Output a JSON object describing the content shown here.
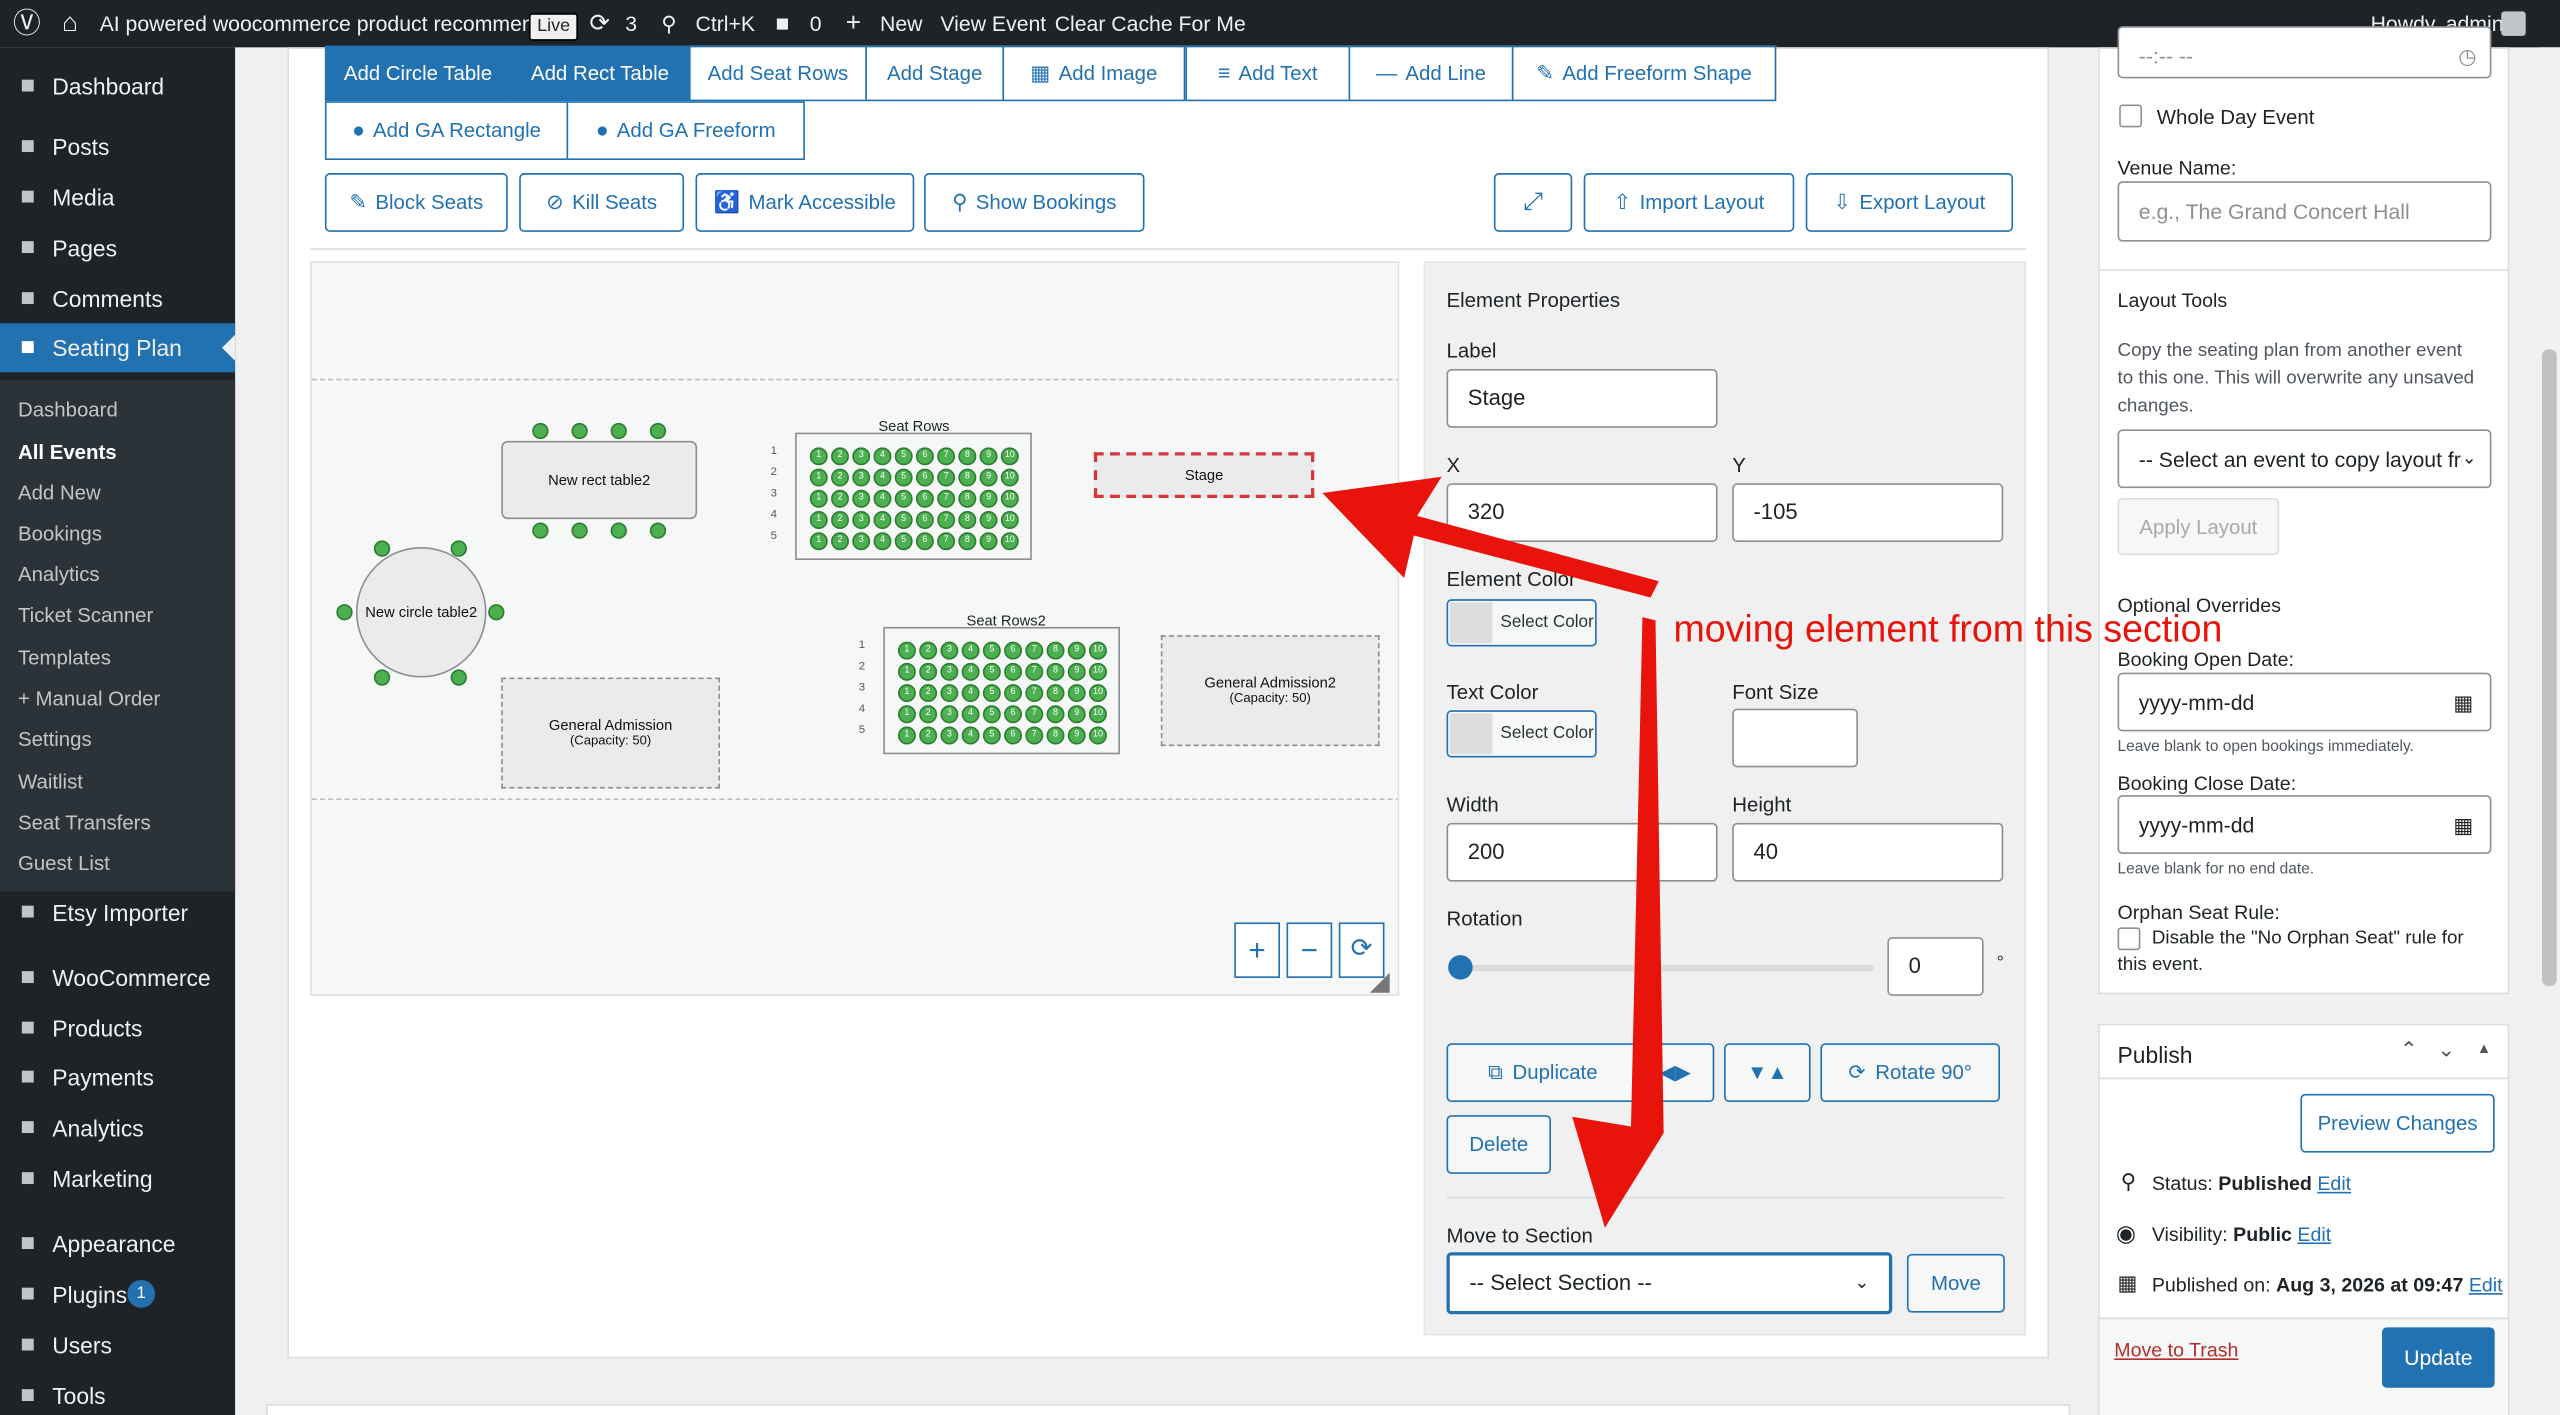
{
  "admin_bar": {
    "site_name": "AI powered woocommerce product recommend...",
    "live_badge": "Live",
    "updates_count": "3",
    "search_shortcut": "Ctrl+K",
    "comments_count": "0",
    "new_label": "New",
    "view_event_label": "View Event",
    "clear_cache_label": "Clear Cache For Me",
    "howdy": "Howdy, admin"
  },
  "sidebar": {
    "items": [
      {
        "label": "Dashboard",
        "icon": "dashboard-icon"
      },
      {
        "label": "Posts",
        "icon": "pin-icon"
      },
      {
        "label": "Media",
        "icon": "media-icon"
      },
      {
        "label": "Pages",
        "icon": "pages-icon"
      },
      {
        "label": "Comments",
        "icon": "comment-icon"
      },
      {
        "label": "Seating Plan",
        "icon": "seating-icon"
      },
      {
        "label": "Etsy Importer",
        "icon": "importer-icon"
      },
      {
        "label": "WooCommerce",
        "icon": "woo-icon"
      },
      {
        "label": "Products",
        "icon": "products-icon"
      },
      {
        "label": "Payments",
        "icon": "payments-icon"
      },
      {
        "label": "Analytics",
        "icon": "analytics-icon"
      },
      {
        "label": "Marketing",
        "icon": "marketing-icon"
      },
      {
        "label": "Appearance",
        "icon": "brush-icon"
      },
      {
        "label": "Plugins",
        "icon": "plugin-icon"
      },
      {
        "label": "Users",
        "icon": "users-icon"
      },
      {
        "label": "Tools",
        "icon": "tools-icon"
      }
    ],
    "plugins_badge": "1",
    "submenu": [
      "Dashboard",
      "All Events",
      "Add New",
      "Bookings",
      "Analytics",
      "Ticket Scanner",
      "Templates",
      "+ Manual Order",
      "Settings",
      "Waitlist",
      "Seat Transfers",
      "Guest List"
    ]
  },
  "toolbar": {
    "row1": [
      "Add Circle Table",
      "Add Rect Table",
      "Add Seat Rows",
      "Add Stage",
      "Add Image",
      "Add Text",
      "Add Line",
      "Add Freeform Shape"
    ],
    "row2": [
      "Add GA Rectangle",
      "Add GA Freeform"
    ],
    "row3": [
      "Block Seats",
      "Kill Seats",
      "Mark Accessible",
      "Show Bookings"
    ],
    "import_label": "Import Layout",
    "export_label": "Export Layout"
  },
  "canvas": {
    "circle_table": "New circle table2",
    "rect_table": "New rect table2",
    "seat_rows_1": "Seat Rows",
    "seat_rows_2": "Seat Rows2",
    "stage": "Stage",
    "ga1_name": "General Admission",
    "ga1_cap": "(Capacity: 50)",
    "ga2_name": "General Admission2",
    "ga2_cap": "(Capacity: 50)",
    "rows_1": [
      "1",
      "2",
      "3",
      "4",
      "5"
    ],
    "rows_2": [
      "1",
      "2",
      "3",
      "4",
      "5"
    ],
    "seat_numbers": [
      "1",
      "2",
      "3",
      "4",
      "5",
      "6",
      "7",
      "8",
      "9",
      "10"
    ],
    "zoom_in": "+",
    "zoom_out": "−"
  },
  "properties": {
    "title": "Element Properties",
    "label_label": "Label",
    "label_value": "Stage",
    "x_label": "X",
    "x_value": "320",
    "y_label": "Y",
    "y_value": "-105",
    "element_color_label": "Element Color",
    "select_color": "Select Color",
    "text_color_label": "Text Color",
    "font_size_label": "Font Size",
    "font_size_value": "",
    "width_label": "Width",
    "width_value": "200",
    "height_label": "Height",
    "height_value": "40",
    "rotation_label": "Rotation",
    "rotation_value": "0",
    "rotation_unit": "°",
    "rotation_fraction": 0,
    "duplicate_label": "Duplicate",
    "rotate90_label": "Rotate 90°",
    "delete_label": "Delete",
    "move_section_label": "Move to Section",
    "section_selected": "-- Select Section --",
    "move_label": "Move"
  },
  "right_panel": {
    "whole_day_label": "Whole Day Event",
    "venue_label": "Venue Name:",
    "venue_placeholder": "e.g., The Grand Concert Hall",
    "layout_tools_title": "Layout Tools",
    "layout_tools_desc": [
      "Copy the seating plan from another event",
      "to this one. This will overwrite any unsaved",
      "changes."
    ],
    "copy_select": "-- Select an event to copy layout fro",
    "apply_layout": "Apply Layout",
    "overrides_title": "Optional Overrides",
    "booking_open_label": "Booking Open Date:",
    "date_placeholder": "yyyy-mm-dd",
    "booking_open_hint": "Leave blank to open bookings immediately.",
    "booking_close_label": "Booking Close Date:",
    "booking_close_hint": "Leave blank for no end date.",
    "orphan_title": "Orphan Seat Rule:",
    "orphan_line1": "Disable the \"No Orphan Seat\" rule for",
    "orphan_line2": "this event."
  },
  "publish": {
    "title": "Publish",
    "preview_label": "Preview Changes",
    "status_label": "Status:",
    "status_value": "Published",
    "visibility_label": "Visibility:",
    "visibility_value": "Public",
    "published_label": "Published on:",
    "published_value": "Aug 3, 2026 at 09:47",
    "edit_label": "Edit",
    "trash_label": "Move to Trash",
    "update_label": "Update"
  },
  "annotation": {
    "text": "moving element from this section",
    "color": "#e8140c"
  },
  "colors": {
    "admin_bar": "#1d2327",
    "accent": "#2271b1",
    "seat": "#4caf50",
    "stage_border": "#d63638"
  }
}
